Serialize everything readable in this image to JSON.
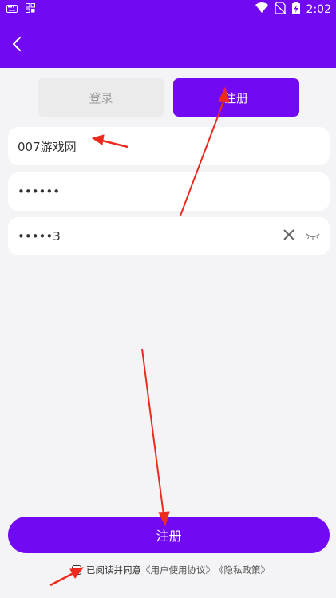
{
  "status_bar": {
    "time": "2:02",
    "left_icons": [
      "keyboard-icon",
      "grid-icon"
    ],
    "right_icons": [
      "wifi-icon",
      "no-sim-icon",
      "battery-charging-icon"
    ]
  },
  "header": {
    "back_icon": "chevron-left-icon",
    "color": "#7109f2"
  },
  "tabs": {
    "login_label": "登录",
    "register_label": "注册",
    "active": "register"
  },
  "form": {
    "username": "007游戏网",
    "password": "••••••",
    "confirm_password": "•••••3",
    "clear_icon": "close-icon",
    "visibility_icon": "eye-closed-icon"
  },
  "submit": {
    "label": "注册"
  },
  "agreement": {
    "text": "已阅读并同意",
    "user_agreement": "《用户使用协议》",
    "privacy_policy": "《隐私政策》",
    "checked": false
  },
  "colors": {
    "accent": "#7109f2",
    "annotation_arrow": "#ee2a1f"
  }
}
